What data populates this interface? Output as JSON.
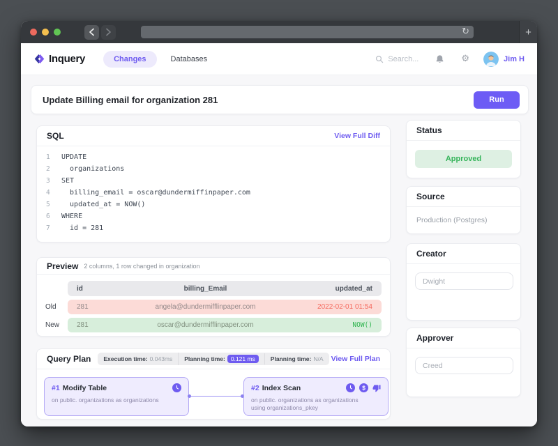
{
  "browser": {
    "refresh_icon": "↻",
    "new_tab_icon": "+",
    "url_value": ""
  },
  "header": {
    "brand": "Inquery",
    "nav": [
      {
        "label": "Changes",
        "active": true
      },
      {
        "label": "Databases",
        "active": false
      }
    ],
    "search_placeholder": "Search...",
    "user_name": "Jim H"
  },
  "page": {
    "title": "Update Billing email for organization 281",
    "run_label": "Run"
  },
  "sql": {
    "title": "SQL",
    "link": "View Full Diff",
    "lines": [
      {
        "num": "1",
        "code": "UPDATE"
      },
      {
        "num": "2",
        "code": "  organizations"
      },
      {
        "num": "3",
        "code": "SET"
      },
      {
        "num": "4",
        "code": "  billing_email = oscar@dundermiffinpaper.com"
      },
      {
        "num": "5",
        "code": "  updated_at = NOW()"
      },
      {
        "num": "6",
        "code": "WHERE"
      },
      {
        "num": "7",
        "code": "  id = 281"
      }
    ]
  },
  "preview": {
    "title": "Preview",
    "subtitle": "2 columns, 1 row changed in organization",
    "columns": [
      "id",
      "billing_Email",
      "updated_at"
    ],
    "rows": [
      {
        "label": "Old",
        "id": "281",
        "email": "angela@dundermifflinpaper.com",
        "updated": "2022-02-01 01:54"
      },
      {
        "label": "New",
        "id": "281",
        "email": "oscar@dundermifflinpaper.com",
        "updated": "NOW()"
      }
    ]
  },
  "query_plan": {
    "title": "Query Plan",
    "stats": [
      {
        "label": "Execution time:",
        "value": "0.043ms",
        "highlight": false
      },
      {
        "label": "Planning time:",
        "value": "0.121 ms",
        "highlight": true
      },
      {
        "label": "Planning time:",
        "value": "N/A",
        "highlight": false
      }
    ],
    "link": "View Full Plan",
    "nodes": [
      {
        "id": "#1",
        "name": "Modify Table",
        "icons": [
          "clock"
        ],
        "line1": "on public. organizations as organizations",
        "line2": ""
      },
      {
        "id": "#2",
        "name": "Index Scan",
        "icons": [
          "clock",
          "dollar",
          "thumbs-down"
        ],
        "line1": "on public. organizations as organizations",
        "line2": "using organizations_pkey"
      }
    ]
  },
  "sidebar": {
    "status": {
      "title": "Status",
      "value": "Approved"
    },
    "source": {
      "title": "Source",
      "value": "Production (Postgres)"
    },
    "creator": {
      "title": "Creator",
      "value": "Dwight"
    },
    "approver": {
      "title": "Approver",
      "value": "Creed"
    }
  },
  "colors": {
    "accent_purple": "#6e5bf0",
    "accent_purple_light": "#edeafc",
    "status_green": "#35b45a",
    "status_green_light": "#def0e3",
    "diff_red": "#f4695e",
    "diff_red_light": "#fcdbd7",
    "diff_green_light": "#d7eedb",
    "page_bg": "#f7f7f9",
    "chrome_bg": "#35383c"
  }
}
